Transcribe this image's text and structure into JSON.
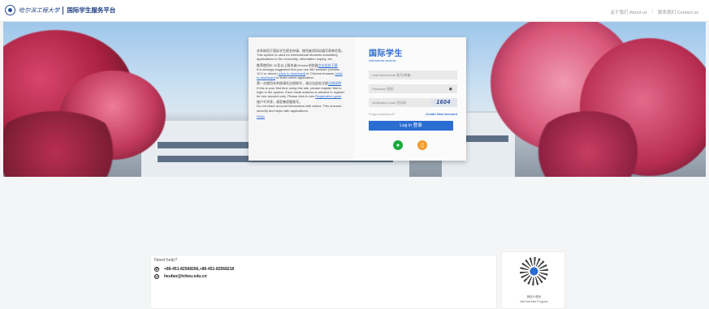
{
  "header": {
    "school_name": "哈尔滨工程大学",
    "platform_name": "国际学生服务平台",
    "about_link": "关于我们 About us",
    "contact_link": "联系我们 Contact us",
    "divider": "|"
  },
  "intro": {
    "p1_cn": "本系统用于国际学生报名申请、使用者须如实填写表单信息。",
    "p1_en": "This system is used for International students submitting applications to the University, information inquiry, etc.",
    "p2_cn": "推荐使用IE 10及以上版本或Chrome浏览器",
    "p2_link": "点击此处下载",
    "p2_en": "It is strongly suggested that you use 360 browser (version 10.0 or above)",
    "p2_link2": "(click to download)",
    "p2_en2": "or Chrome browser",
    "p2_link3": "(click to download)",
    "p2_en3": "to finish online application.",
    "p3_cn": "第一次使用本系统请先注册账号，请点击此处注册",
    "p3_link": "注册说明",
    "p3_en": "If this is your first time using this site, please register first to login in the system. Each email address is allowed to register for one account only. Please click to see",
    "p3_link2": "Registration guide",
    "p4_cn": "账户不共享，请妥善保管账号。",
    "p4_en": "Do not share account information with others. This ensures security and helps with applications.",
    "faq": "FAQs"
  },
  "login": {
    "brand_title": "国际学生",
    "brand_sub": "International students",
    "username_placeholder": "Username/email 账号/邮箱",
    "password_placeholder": "Password 密码",
    "verification_placeholder": "Verification code 验证码",
    "captcha_text": "1604",
    "forgot": "Forgot password?",
    "create": "Create New Account",
    "login_button": "Log in 登录",
    "eye_icon": "eye-off-icon",
    "social_icons": [
      "wechat-icon",
      "phone-icon"
    ]
  },
  "help": {
    "title": "Need help?",
    "phone": "+86-451-82568266,+86-451-82568218",
    "email": "heufao@hrbeu.edu.cn"
  },
  "qr": {
    "label_cn": "微信小程序",
    "label_en": "WeChat Mini Program"
  },
  "colors": {
    "accent": "#2b6dd1",
    "header_text": "#1f3f84",
    "wechat": "#1aab3c",
    "phone": "#f39c2c"
  }
}
